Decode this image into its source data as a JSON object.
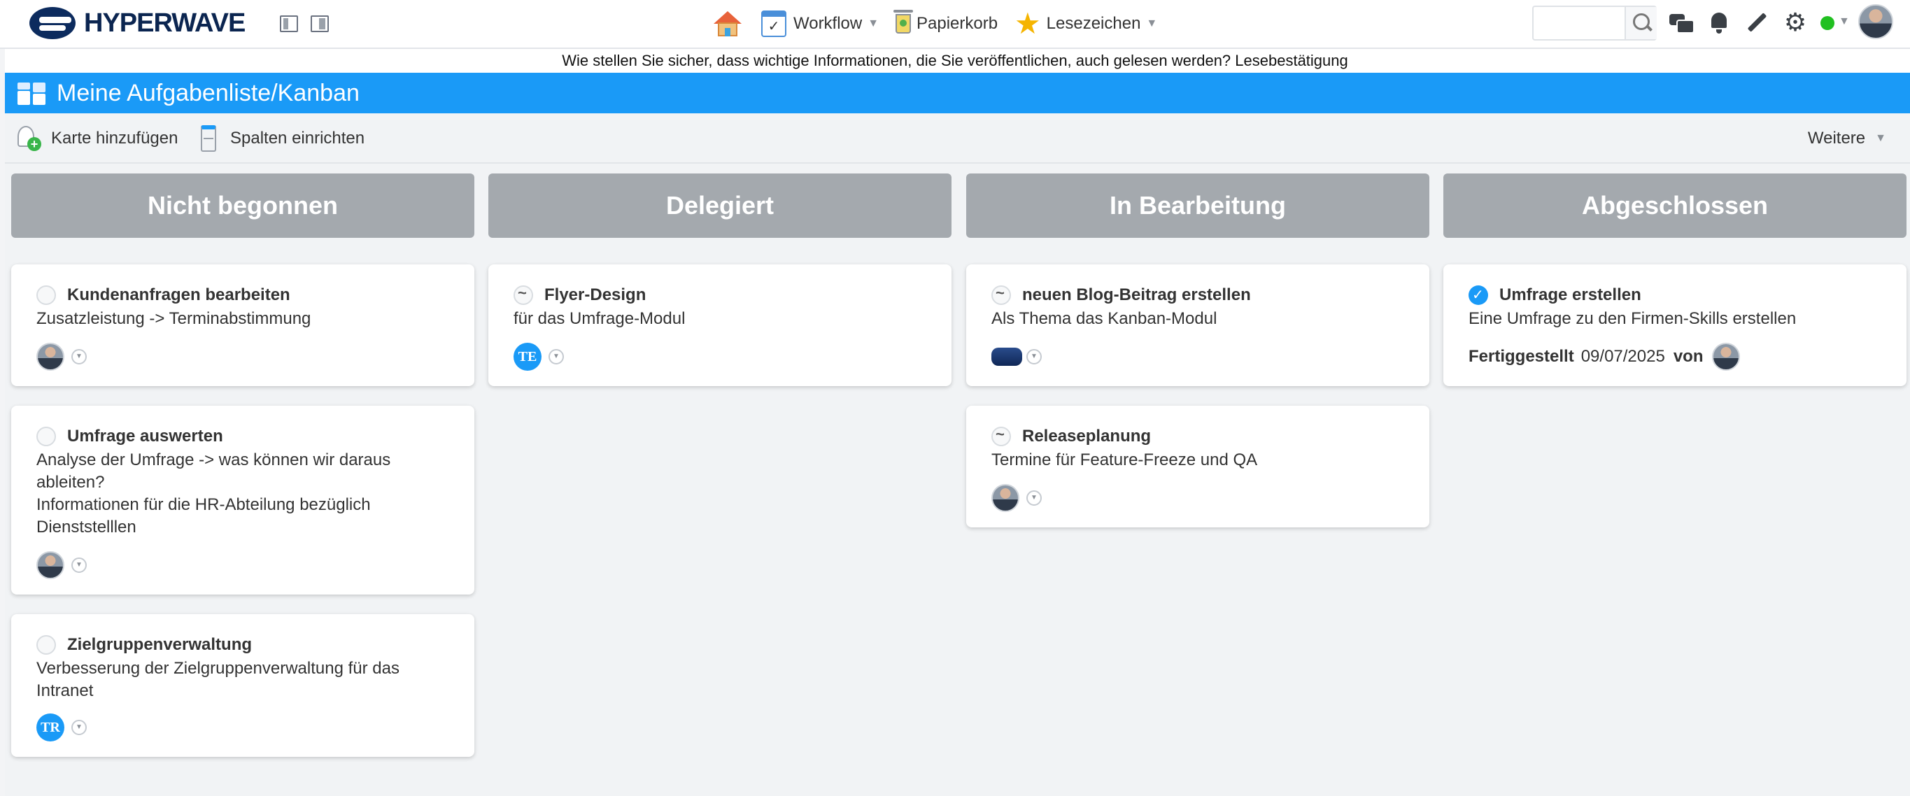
{
  "app": {
    "brand": "HYPERWAVE"
  },
  "topnav": {
    "workflow_label": "Workflow",
    "trash_label": "Papierkorb",
    "bookmarks_label": "Lesezeichen",
    "search_placeholder": "",
    "online_status_color": "#21c021"
  },
  "notice": {
    "text": "Wie stellen Sie sicher, dass wichtige Informationen, die Sie veröffentlichen, auch gelesen werden?  Lesebestätigung"
  },
  "page": {
    "title": "Meine Aufgabenliste/Kanban",
    "accent_color": "#1a9af7"
  },
  "toolbar": {
    "add_card_label": "Karte hinzufügen",
    "setup_columns_label": "Spalten einrichten",
    "more_label": "Weitere"
  },
  "columns": [
    {
      "title": "Nicht begonnen",
      "cards": [
        {
          "title": "Kundenanfragen bearbeiten",
          "description": "Zusatzleistung -> Terminabstimmung",
          "status": "not-started",
          "assignee": "photo"
        },
        {
          "title": "Umfrage auswerten",
          "description": "Analyse der Umfrage -> was können wir daraus\nableiten?\nInformationen für die HR-Abteilung bezüglich\nDienststelllen",
          "status": "not-started",
          "assignee": "photo"
        },
        {
          "title": "Zielgruppenverwaltung",
          "description": "Verbesserung der Zielgruppenverwaltung für das\nIntranet",
          "status": "not-started",
          "assignee_initials": "TR"
        }
      ]
    },
    {
      "title": "Delegiert",
      "cards": [
        {
          "title": "Flyer-Design",
          "description": "für das Umfrage-Modul",
          "status": "in-progress",
          "assignee_initials": "TE"
        }
      ]
    },
    {
      "title": "In Bearbeitung",
      "cards": [
        {
          "title": "neuen Blog-Beitrag erstellen",
          "description": "Als Thema das Kanban-Modul",
          "status": "in-progress",
          "assignee": "group"
        },
        {
          "title": "Releaseplanung",
          "description": "Termine für Feature-Freeze und QA",
          "status": "in-progress",
          "assignee": "photo"
        }
      ]
    },
    {
      "title": "Abgeschlossen",
      "cards": [
        {
          "title": "Umfrage erstellen",
          "description": "Eine Umfrage zu den Firmen-Skills erstellen",
          "status": "done",
          "completed_label": "Fertiggestellt",
          "completed_date": "09/07/2025",
          "completed_by_label": "von"
        }
      ]
    }
  ]
}
